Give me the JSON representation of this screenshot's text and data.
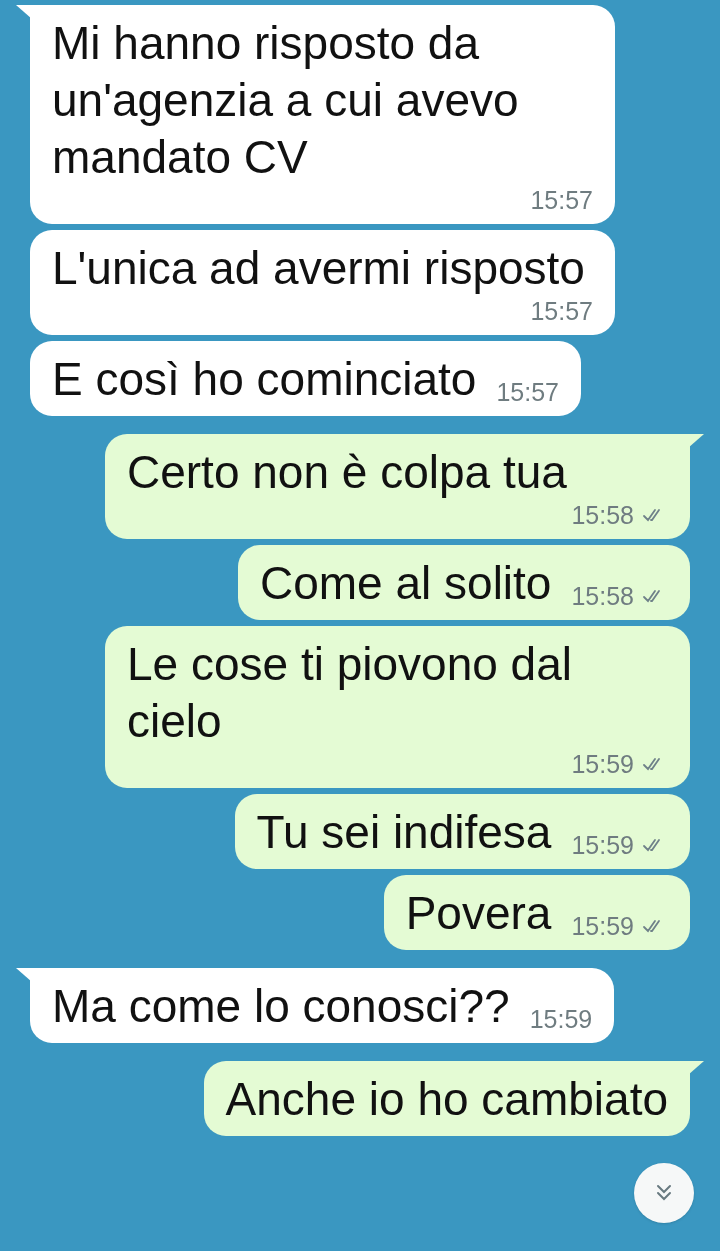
{
  "messages": [
    {
      "kind": "incoming",
      "tail": true,
      "text": "Mi hanno risposto da un'agenzia a cui avevo mandato CV",
      "time": "15:57"
    },
    {
      "kind": "incoming",
      "tail": false,
      "text": "L'unica ad avermi risposto",
      "time": "15:57"
    },
    {
      "kind": "incoming",
      "tail": false,
      "text": "E così ho cominciato",
      "time": "15:57"
    },
    {
      "kind": "outgoing",
      "tail": true,
      "text": "Certo non è colpa tua",
      "time": "15:58"
    },
    {
      "kind": "outgoing",
      "tail": false,
      "text": "Come al solito",
      "time": "15:58"
    },
    {
      "kind": "outgoing",
      "tail": false,
      "text": "Le cose ti piovono dal cielo",
      "time": "15:59"
    },
    {
      "kind": "outgoing",
      "tail": false,
      "text": "Tu sei indifesa",
      "time": "15:59"
    },
    {
      "kind": "outgoing",
      "tail": false,
      "text": "Povera",
      "time": "15:59"
    },
    {
      "kind": "incoming",
      "tail": true,
      "text": "Ma come lo conosci??",
      "time": "15:59"
    },
    {
      "kind": "outgoing",
      "tail": true,
      "text": "Anche io ho cambiato"
    }
  ]
}
